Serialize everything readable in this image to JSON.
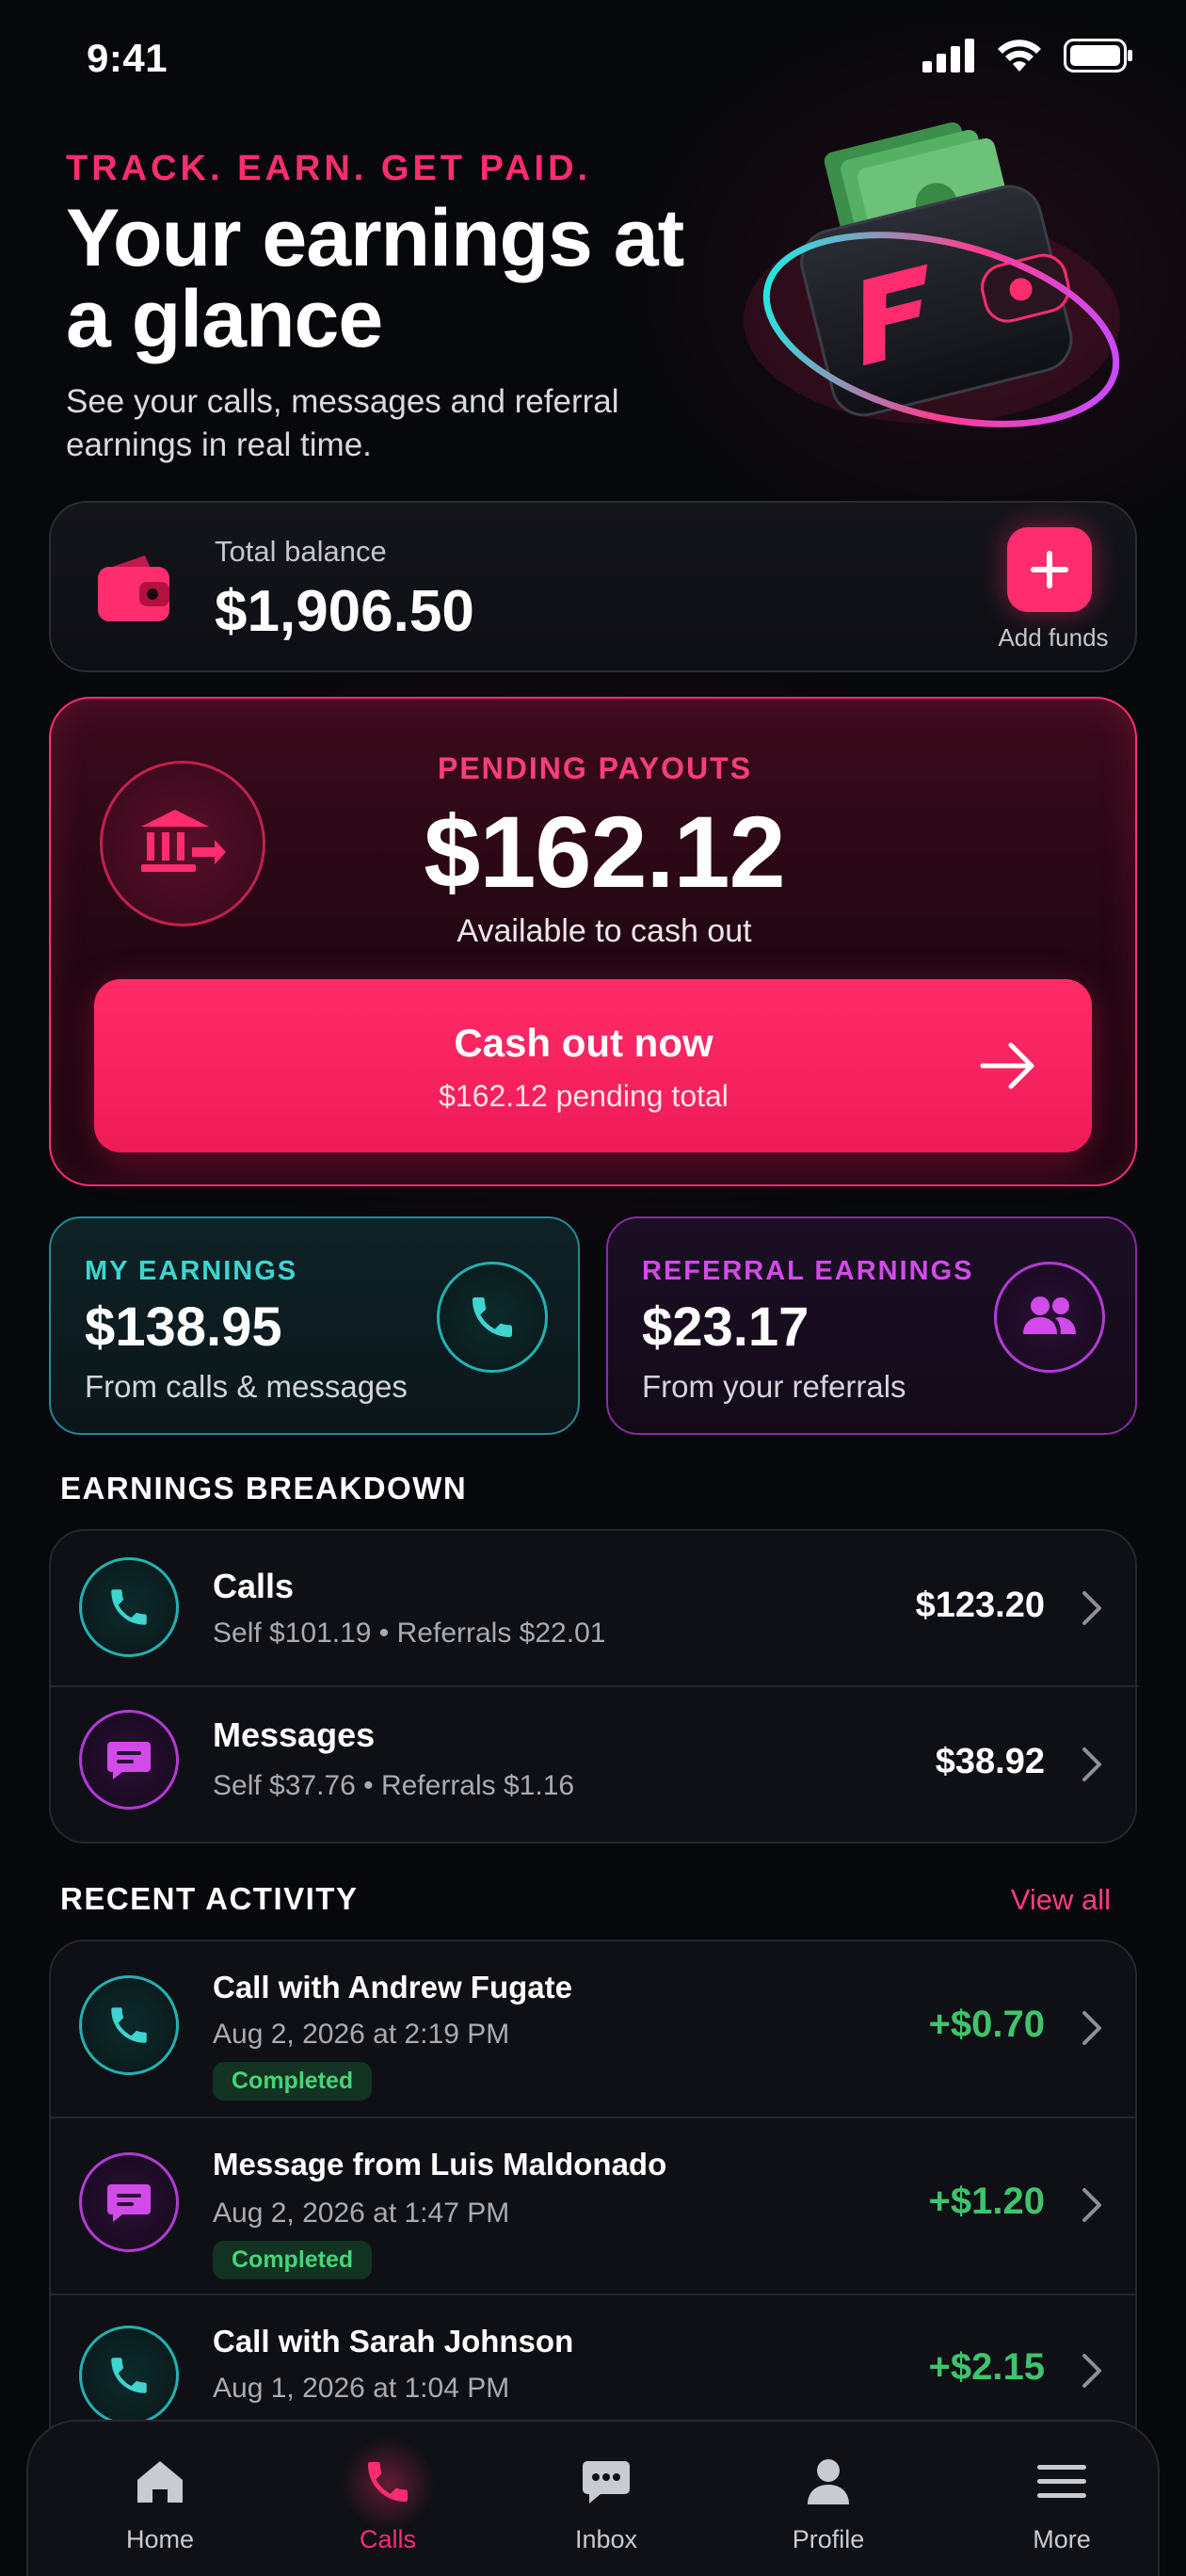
{
  "status_bar": {
    "time": "9:41"
  },
  "hero": {
    "eyebrow": "TRACK. EARN. GET PAID.",
    "title": "Your earnings at a glance",
    "subtitle": "See your calls, messages and referral earnings in real time."
  },
  "balance": {
    "label": "Total balance",
    "value": "$1,906.50",
    "add_label": "Add funds"
  },
  "payout": {
    "label": "PENDING PAYOUTS",
    "value": "$162.12",
    "subtitle": "Available to cash out",
    "button_title": "Cash out now",
    "button_sub": "$162.12 pending total"
  },
  "my_earnings": {
    "label": "MY EARNINGS",
    "value": "$138.95",
    "sub": "From calls & messages",
    "color": "#3fd4d0"
  },
  "referral_earnings": {
    "label": "REFERRAL EARNINGS",
    "value": "$23.17",
    "sub": "From your referrals",
    "color": "#d24be8"
  },
  "breakdown": {
    "title": "EARNINGS BREAKDOWN",
    "rows": [
      {
        "title": "Calls",
        "sub": "Self $101.19 • Referrals $22.01",
        "amount": "$123.20",
        "icon": "phone-icon"
      },
      {
        "title": "Messages",
        "sub": "Self $37.76 • Referrals $1.16",
        "amount": "$38.92",
        "icon": "message-icon"
      }
    ]
  },
  "activity": {
    "title": "RECENT ACTIVITY",
    "view_all": "View all",
    "items": [
      {
        "title": "Call with Andrew Fugate",
        "time": "Aug 2, 2026 at 2:19 PM",
        "status": "Completed",
        "amount": "+$0.70",
        "icon": "phone-icon"
      },
      {
        "title": "Message from Luis Maldonado",
        "time": "Aug 2, 2026 at 1:47 PM",
        "status": "Completed",
        "amount": "+$1.20",
        "icon": "message-icon"
      },
      {
        "title": "Call with Sarah Johnson",
        "time": "Aug 1, 2026 at 1:04 PM",
        "amount": "+$2.15",
        "icon": "phone-icon"
      }
    ]
  },
  "tabbar": {
    "active": "Calls",
    "tabs": [
      {
        "label": "Home",
        "icon": "home-icon"
      },
      {
        "label": "Calls",
        "icon": "phone-icon"
      },
      {
        "label": "Inbox",
        "icon": "chat-icon"
      },
      {
        "label": "Profile",
        "icon": "person-icon"
      },
      {
        "label": "More",
        "icon": "menu-icon"
      }
    ]
  },
  "colors": {
    "accent": "#ff2d6f",
    "teal": "#20b3b0",
    "purple": "#b23ad6",
    "positive": "#3ec46d"
  }
}
